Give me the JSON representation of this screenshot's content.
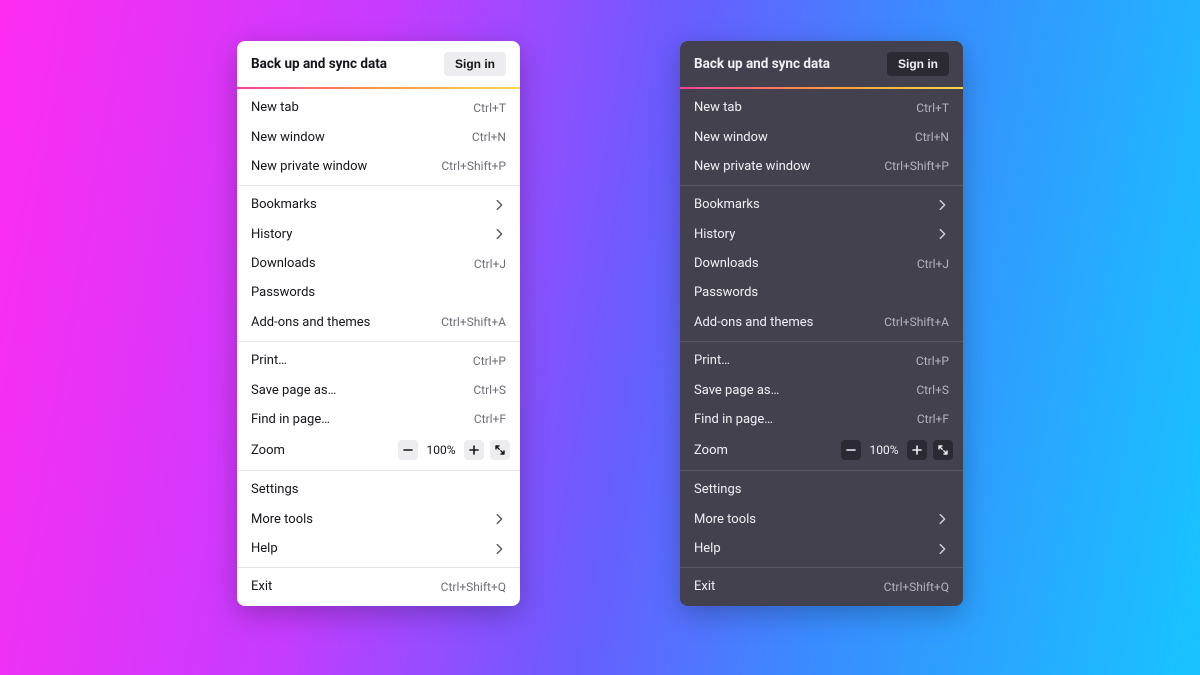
{
  "header": {
    "title": "Back up and sync data",
    "signin": "Sign in"
  },
  "sections": {
    "s1": {
      "new_tab": {
        "label": "New tab",
        "shortcut": "Ctrl+T"
      },
      "new_window": {
        "label": "New window",
        "shortcut": "Ctrl+N"
      },
      "new_private": {
        "label": "New private window",
        "shortcut": "Ctrl+Shift+P"
      }
    },
    "s2": {
      "bookmarks": {
        "label": "Bookmarks"
      },
      "history": {
        "label": "History"
      },
      "downloads": {
        "label": "Downloads",
        "shortcut": "Ctrl+J"
      },
      "passwords": {
        "label": "Passwords"
      },
      "addons": {
        "label": "Add-ons and themes",
        "shortcut": "Ctrl+Shift+A"
      }
    },
    "s3": {
      "print": {
        "label": "Print…",
        "shortcut": "Ctrl+P"
      },
      "save_as": {
        "label": "Save page as…",
        "shortcut": "Ctrl+S"
      },
      "find": {
        "label": "Find in page…",
        "shortcut": "Ctrl+F"
      },
      "zoom": {
        "label": "Zoom",
        "value": "100%"
      }
    },
    "s4": {
      "settings": {
        "label": "Settings"
      },
      "more_tools": {
        "label": "More tools"
      },
      "help": {
        "label": "Help"
      }
    },
    "s5": {
      "exit": {
        "label": "Exit",
        "shortcut": "Ctrl+Shift+Q"
      }
    }
  }
}
